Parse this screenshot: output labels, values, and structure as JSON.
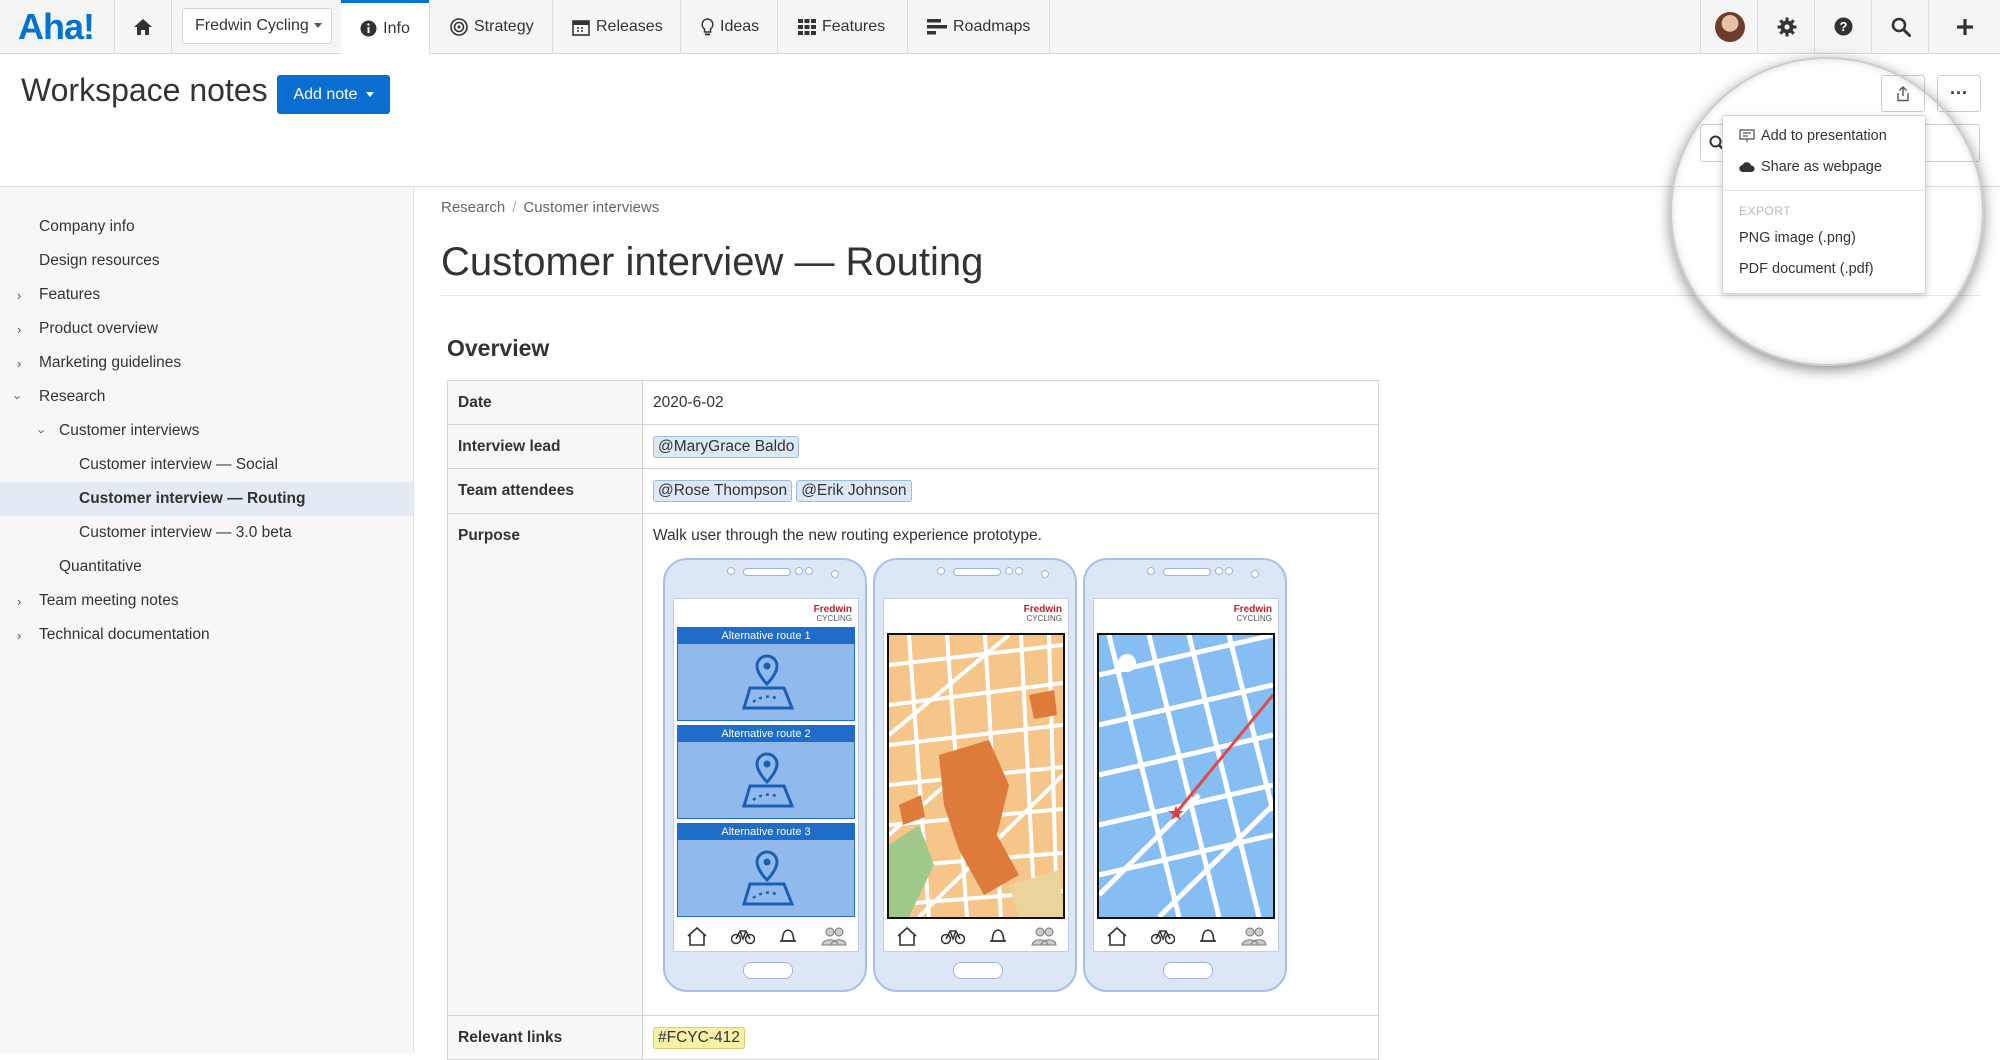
{
  "nav": {
    "logo": "Aha!",
    "workspace": "Fredwin Cycling",
    "tabs": [
      {
        "label": "Info",
        "icon": "info-icon"
      },
      {
        "label": "Strategy",
        "icon": "target-icon"
      },
      {
        "label": "Releases",
        "icon": "calendar-icon"
      },
      {
        "label": "Ideas",
        "icon": "lightbulb-icon"
      },
      {
        "label": "Features",
        "icon": "grid-icon"
      },
      {
        "label": "Roadmaps",
        "icon": "roadmap-icon"
      }
    ],
    "active_tab": "Info",
    "accent_color": "#0073cf"
  },
  "header": {
    "title": "Workspace notes",
    "add_note": "Add note"
  },
  "share_menu": {
    "items": [
      "Add to presentation",
      "Share as webpage"
    ],
    "export_heading": "EXPORT",
    "export_items": [
      "PNG image (.png)",
      "PDF document (.pdf)"
    ]
  },
  "sidebar": {
    "items": [
      {
        "label": "Company info"
      },
      {
        "label": "Design resources"
      },
      {
        "label": "Features"
      },
      {
        "label": "Product overview"
      },
      {
        "label": "Marketing guidelines"
      },
      {
        "label": "Research"
      },
      {
        "label": "Customer interviews"
      },
      {
        "label": "Customer interview — Social"
      },
      {
        "label": "Customer interview — Routing"
      },
      {
        "label": "Customer interview — 3.0 beta"
      },
      {
        "label": "Quantitative"
      },
      {
        "label": "Team meeting notes"
      },
      {
        "label": "Technical documentation"
      }
    ],
    "selected": "Customer interview — Routing"
  },
  "doc": {
    "breadcrumb": [
      "Research",
      "Customer interviews"
    ],
    "title": "Customer interview — Routing",
    "section": "Overview",
    "rows": {
      "date_label": "Date",
      "date": "2020-6-02",
      "lead_label": "Interview lead",
      "lead": "@MaryGrace Baldo",
      "attendees_label": "Team attendees",
      "attendees": [
        "@Rose Thompson",
        "@Erik Johnson"
      ],
      "purpose_label": "Purpose",
      "purpose": "Walk user through the new routing experience prototype.",
      "links_label": "Relevant links",
      "links": "#FCYC-412"
    }
  },
  "mockup": {
    "brand": "Fredwin",
    "brand_sub": "CYCLING",
    "routes": [
      "Alternative route 1",
      "Alternative route 2",
      "Alternative route 3"
    ]
  }
}
